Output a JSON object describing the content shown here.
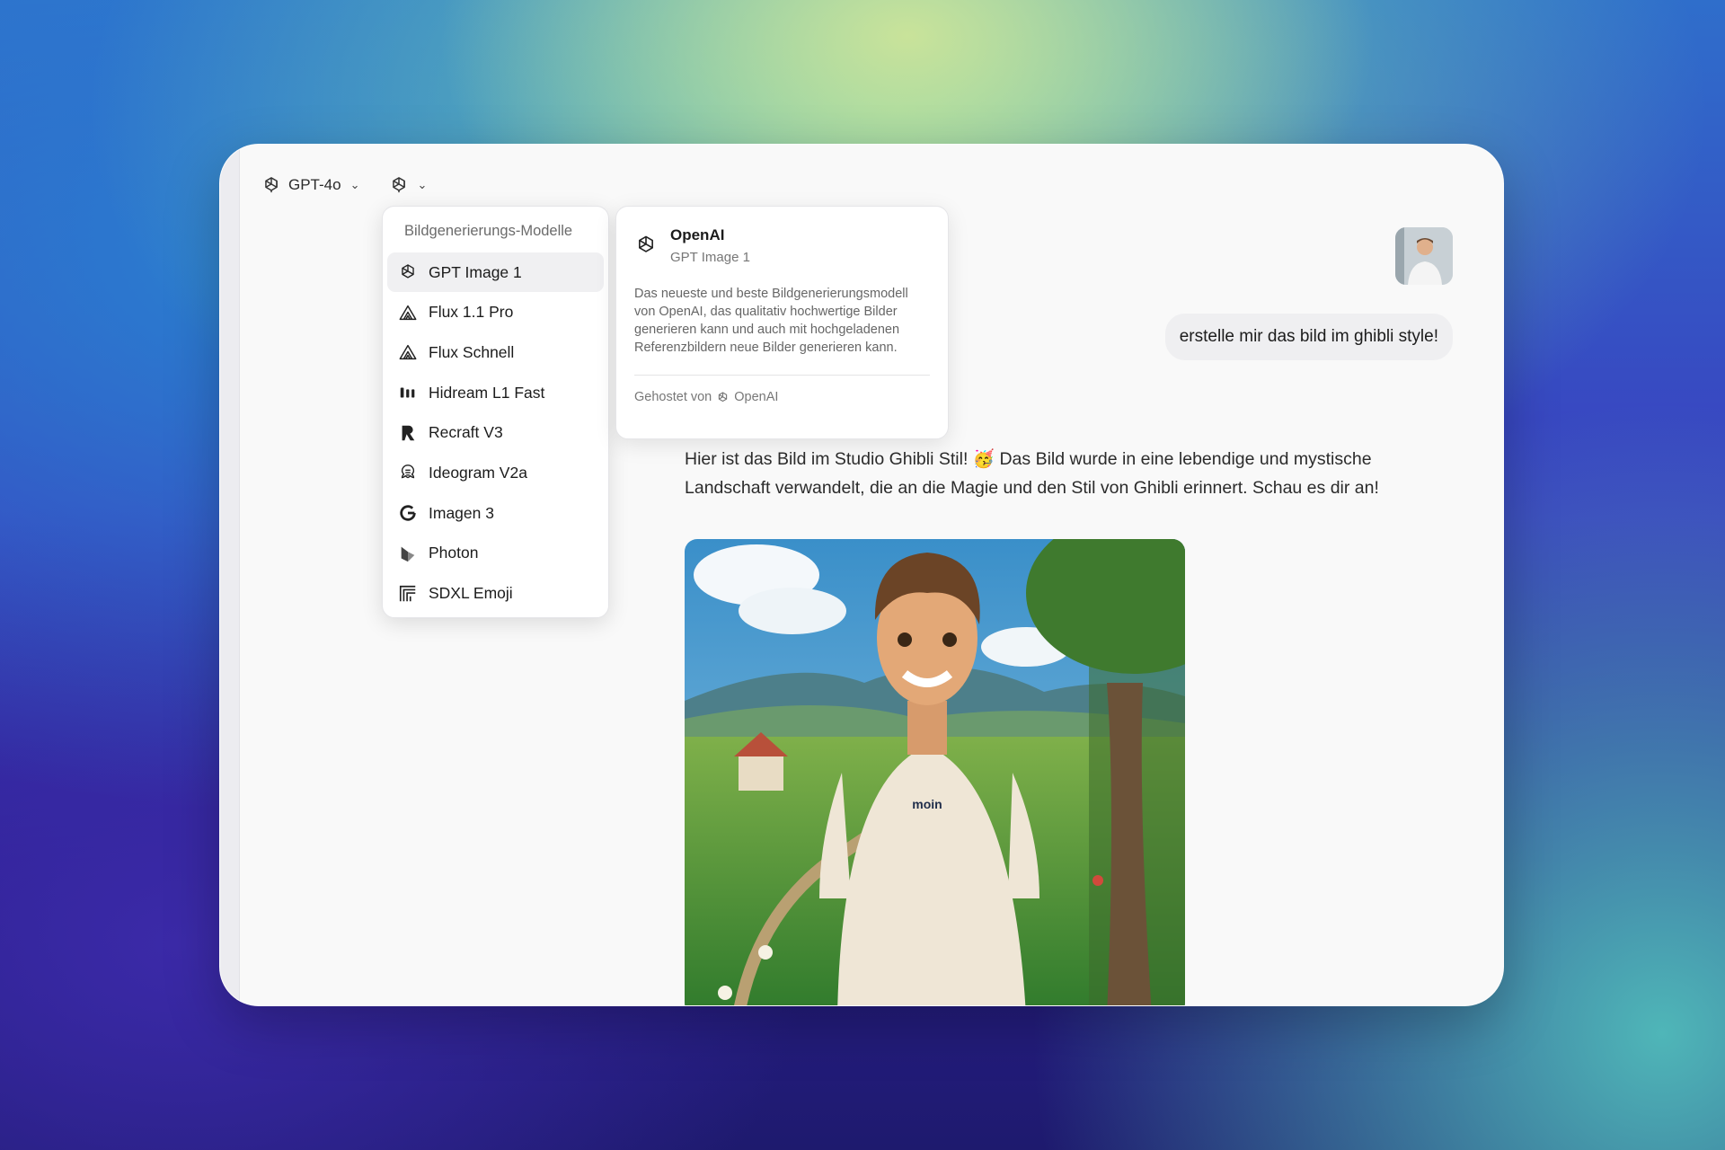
{
  "toolbar": {
    "chat_model_label": "GPT-4o",
    "chat_model_icon": "openai-icon",
    "image_model_icon": "openai-icon"
  },
  "dropdown": {
    "title": "Bildgenerierungs-Modelle",
    "items": [
      {
        "label": "GPT Image 1",
        "icon": "openai-icon",
        "selected": true
      },
      {
        "label": "Flux 1.1 Pro",
        "icon": "flux-icon"
      },
      {
        "label": "Flux Schnell",
        "icon": "flux-icon"
      },
      {
        "label": "Hidream L1 Fast",
        "icon": "hidream-icon"
      },
      {
        "label": "Recraft V3",
        "icon": "recraft-icon"
      },
      {
        "label": "Ideogram V2a",
        "icon": "ideogram-icon"
      },
      {
        "label": "Imagen 3",
        "icon": "google-icon"
      },
      {
        "label": "Photon",
        "icon": "photon-icon"
      },
      {
        "label": "SDXL Emoji",
        "icon": "sdxl-icon"
      }
    ]
  },
  "detail": {
    "provider": "OpenAI",
    "model": "GPT Image 1",
    "description": "Das neueste und beste Bildgenerierungsmodell von OpenAI, das qualitativ hochwertige Bilder generieren kann und auch mit hochgeladenen Referenzbildern neue Bilder generieren kann.",
    "hosted_prefix": "Gehostet von",
    "hosted_by": "OpenAI"
  },
  "chat": {
    "user_message": "erstelle mir das bild im ghibli style!",
    "assistant_message": "Hier ist das Bild im Studio Ghibli Stil! 🥳 Das Bild wurde in eine lebendige und mystische Landschaft verwandelt, die an die Magie und den Stil von Ghibli erinnert. Schau es dir an!",
    "image_shirt_text": "moin"
  },
  "colors": {
    "window_bg": "#f9f9f9",
    "menu_active_bg": "#f0f0f2",
    "user_bubble_bg": "#efeff1"
  }
}
